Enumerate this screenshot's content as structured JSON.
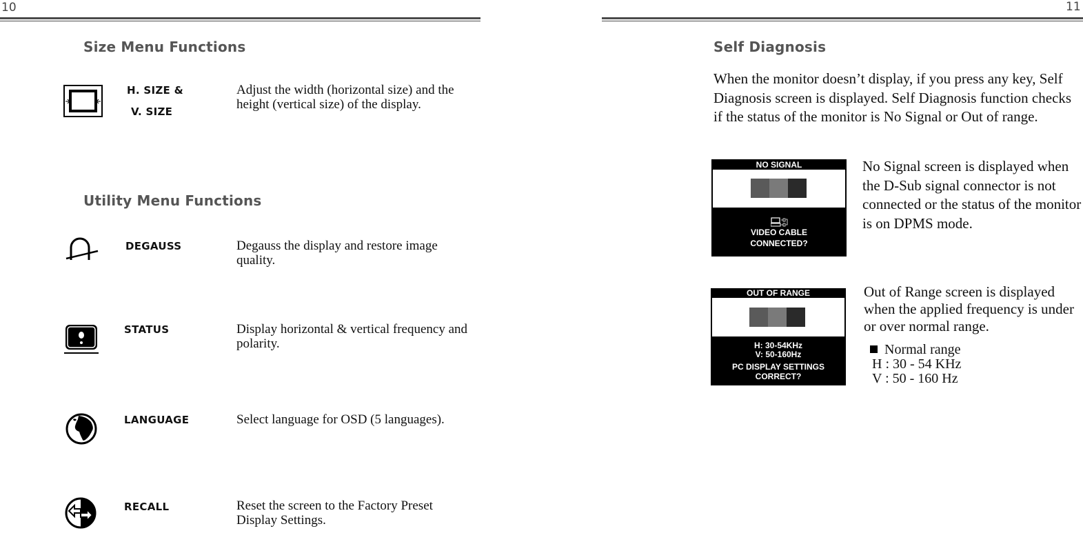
{
  "left_page": {
    "page_number": "10",
    "size_section": {
      "heading": "Size Menu Functions",
      "items": [
        {
          "label_line1": "H. SIZE &",
          "label_line2": "V. SIZE",
          "icon": "size-frame-icon",
          "description": "Adjust the width (horizontal size) and the height (vertical size) of the display."
        }
      ]
    },
    "utility_section": {
      "heading": "Utility Menu Functions",
      "items": [
        {
          "label": "DEGAUSS",
          "icon": "degauss-icon",
          "description": "Degauss the display and restore image quality."
        },
        {
          "label": "STATUS",
          "icon": "status-monitor-icon",
          "description": "Display horizontal & vertical frequency and polarity."
        },
        {
          "label": "LANGUAGE",
          "icon": "globe-icon",
          "description": "Select language for OSD (5 languages)."
        },
        {
          "label": "RECALL",
          "icon": "recall-arrows-icon",
          "description": "Reset the screen to the Factory Preset Display Settings."
        }
      ]
    }
  },
  "right_page": {
    "page_number": "11",
    "heading": "Self Diagnosis",
    "intro": "When the monitor doesn’t  display, if you press any key, Self Diagnosis screen is displayed.  Self Diagnosis function checks if the status of the monitor is No Signal or Out of range.",
    "no_signal": {
      "osd_title": "NO SIGNAL",
      "osd_icon": "pc-cable-icon",
      "osd_message_line1": "VIDEO CABLE",
      "osd_message_line2": "CONNECTED?",
      "bar_colors": [
        "#5a5a5a",
        "#7a7a7a",
        "#2a2a2a"
      ],
      "description": "No Signal screen is displayed when the D-Sub signal connector is not connected or the status of the monitor is on DPMS mode."
    },
    "out_of_range": {
      "osd_title": "OUT OF RANGE",
      "osd_h": "H: 30-54KHz",
      "osd_v": "V: 50-160Hz",
      "osd_message_line1": "PC DISPLAY SETTINGS",
      "osd_message_line2": "CORRECT?",
      "bar_colors": [
        "#5a5a5a",
        "#7a7a7a",
        "#2a2a2a"
      ],
      "description": "Out of Range screen is displayed when the applied frequency is under or over normal range.",
      "normal_range_title": "Normal range",
      "normal_range_h": "H : 30 - 54 KHz",
      "normal_range_v": "V : 50 - 160 Hz"
    }
  }
}
